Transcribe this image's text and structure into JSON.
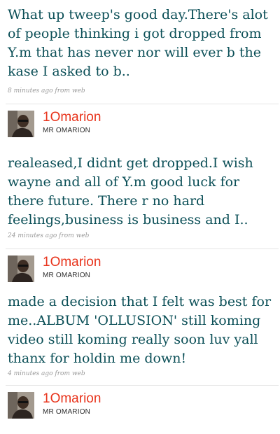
{
  "tweets": [
    {
      "text": "What up tweep's good day.There's alot of people thinking i got dropped from Y.m that has never nor will ever b the kase I asked to b..",
      "meta": "8 minutes ago from web"
    },
    {
      "author": {
        "username": "1Omarion",
        "fullname": "MR OMARION",
        "avatar_icon": "profile-photo"
      },
      "text": "realeased,I didnt get dropped.I wish wayne and all of Y.m good luck for there future. There r no hard feelings,business is business and I..",
      "meta": "24 minutes ago from web"
    },
    {
      "author": {
        "username": "1Omarion",
        "fullname": "MR OMARION",
        "avatar_icon": "profile-photo"
      },
      "text": "made a decision that I felt was best for me..ALBUM 'OLLUSION' still koming video still koming really soon luv yall thanx for holdin me down!",
      "meta": "4 minutes ago from web"
    },
    {
      "author": {
        "username": "1Omarion",
        "fullname": "MR OMARION",
        "avatar_icon": "profile-photo"
      }
    }
  ],
  "colors": {
    "tweet_text": "#0b4f57",
    "username": "#e8341c",
    "meta": "#9a9a9a",
    "divider": "#e5e5e5"
  }
}
